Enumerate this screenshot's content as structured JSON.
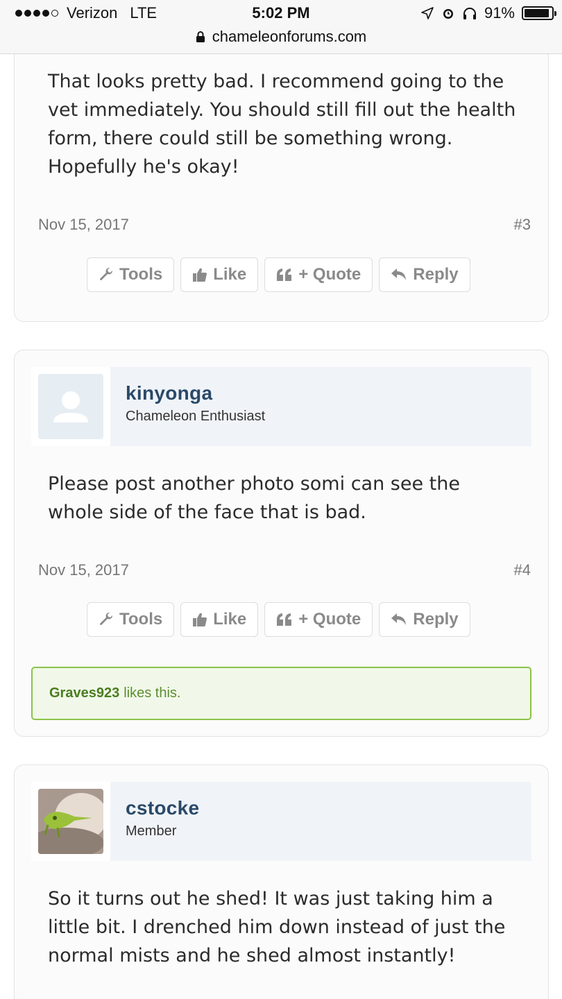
{
  "status_bar": {
    "carrier": "Verizon",
    "network": "LTE",
    "time": "5:02 PM",
    "battery": "91%",
    "battery_level": 0.91,
    "url": "chameleonforums.com"
  },
  "buttons": {
    "tools": "Tools",
    "like": "Like",
    "quote": "+ Quote",
    "reply": "Reply"
  },
  "posts": [
    {
      "message": "That looks pretty bad. I recommend going to the vet immediately. You should still fill out the health form, there could still be something wrong. Hopefully he's okay!",
      "date": "Nov 15, 2017",
      "number": "#3"
    },
    {
      "username": "kinyonga",
      "user_title": "Chameleon Enthusiast",
      "message": "Please post another photo somi can see the whole side of the face that is bad.",
      "date": "Nov 15, 2017",
      "number": "#4",
      "likes": {
        "user": "Graves923",
        "text": "likes this."
      }
    },
    {
      "username": "cstocke",
      "user_title": "Member",
      "message": "So it turns out he shed! It was just taking him a little bit. I drenched him down instead of just the normal mists and he shed almost instantly!"
    }
  ],
  "colors": {
    "username": "#2a4968",
    "button_text": "#8a8a8a",
    "likes_border": "#8bc34a",
    "likes_bg": "#f1f8e9"
  }
}
